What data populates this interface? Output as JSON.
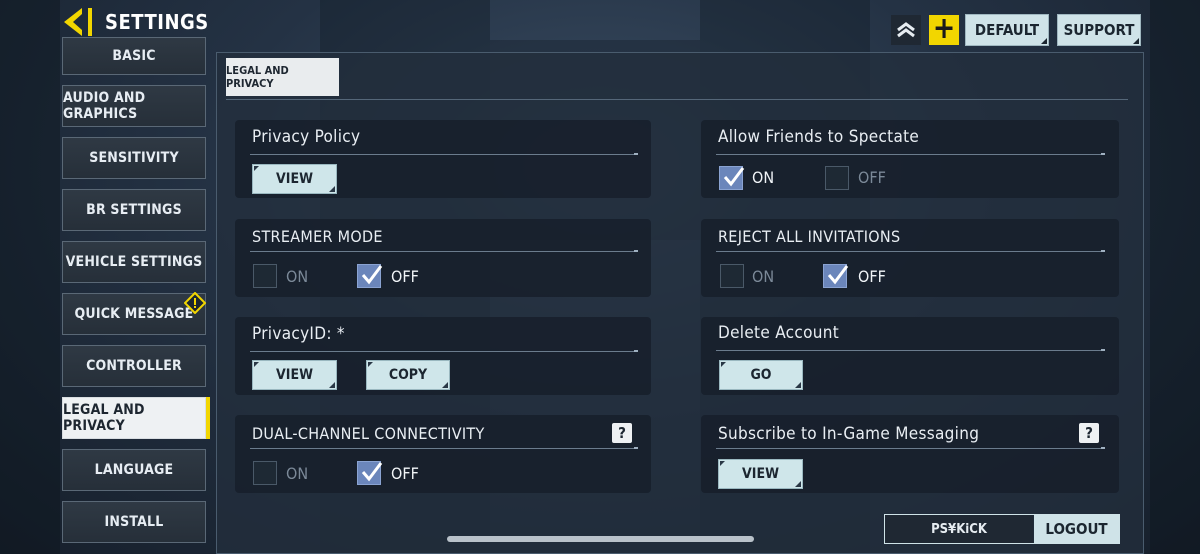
{
  "header": {
    "title": "SETTINGS",
    "default_label": "DEFAULT",
    "support_label": "SUPPORT",
    "plus_glyph": "+"
  },
  "sidebar": {
    "items": [
      {
        "label": "BASIC",
        "active": false
      },
      {
        "label": "AUDIO AND GRAPHICS",
        "active": false
      },
      {
        "label": "SENSITIVITY",
        "active": false
      },
      {
        "label": "BR SETTINGS",
        "active": false
      },
      {
        "label": "VEHICLE SETTINGS",
        "active": false
      },
      {
        "label": "QUICK MESSAGE",
        "active": false,
        "warning_icon": "warning-icon"
      },
      {
        "label": "CONTROLLER",
        "active": false
      },
      {
        "label": "LEGAL AND PRIVACY",
        "active": true
      },
      {
        "label": "LANGUAGE",
        "active": false
      },
      {
        "label": "INSTALL",
        "active": false
      }
    ]
  },
  "main": {
    "tab_label": "LEGAL AND PRIVACY",
    "privacy_policy": {
      "title": "Privacy Policy",
      "view_label": "VIEW"
    },
    "allow_friends": {
      "title": "Allow Friends to Spectate",
      "on_label": "ON",
      "off_label": "OFF",
      "value": "ON"
    },
    "streamer_mode": {
      "title": "STREAMER MODE",
      "on_label": "ON",
      "off_label": "OFF",
      "value": "OFF"
    },
    "reject_invitations": {
      "title": "REJECT ALL INVITATIONS",
      "on_label": "ON",
      "off_label": "OFF",
      "value": "OFF"
    },
    "privacy_id": {
      "title": "PrivacyID: *",
      "view_label": "VIEW",
      "copy_label": "COPY"
    },
    "delete_account": {
      "title": "Delete Account",
      "go_label": "GO"
    },
    "dual_channel": {
      "title": "DUAL-CHANNEL CONNECTIVITY",
      "on_label": "ON",
      "off_label": "OFF",
      "value": "OFF",
      "help_glyph": "?"
    },
    "subscribe_messaging": {
      "title": "Subscribe to In-Game Messaging",
      "view_label": "VIEW",
      "help_glyph": "?"
    }
  },
  "footer": {
    "username": "PS¥KiCK",
    "logout_label": "LOGOUT"
  },
  "colors": {
    "accent_yellow": "#f2d600",
    "button_bg": "#cfe6ea",
    "checkbox_on": "#6b86bb"
  }
}
